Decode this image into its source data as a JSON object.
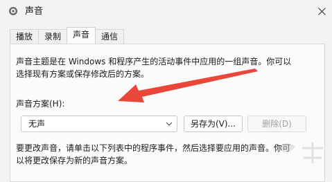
{
  "window": {
    "title": "声音",
    "close_icon": "×"
  },
  "tabs": [
    {
      "label": "播放",
      "active": false
    },
    {
      "label": "录制",
      "active": false
    },
    {
      "label": "声音",
      "active": true
    },
    {
      "label": "通信",
      "active": false
    }
  ],
  "content": {
    "description_line1": "声音主题是在 Windows 和程序产生的活动事件中应用的一组声音。你可以",
    "description_line2": "选择现有方案或保存修改后的方案。",
    "scheme_label": "声音方案(H):",
    "scheme_value": "无声",
    "save_as_label": "另存为(V)...",
    "delete_label": "删除(D)",
    "instruction_line1": "要更改声音，请单击以下列表中的程序事件，然后选择要应用的声音。你可",
    "instruction_line2": "以将更改保存为新的声音方案。"
  },
  "annotation": {
    "arrow_color": "#e8473a"
  }
}
